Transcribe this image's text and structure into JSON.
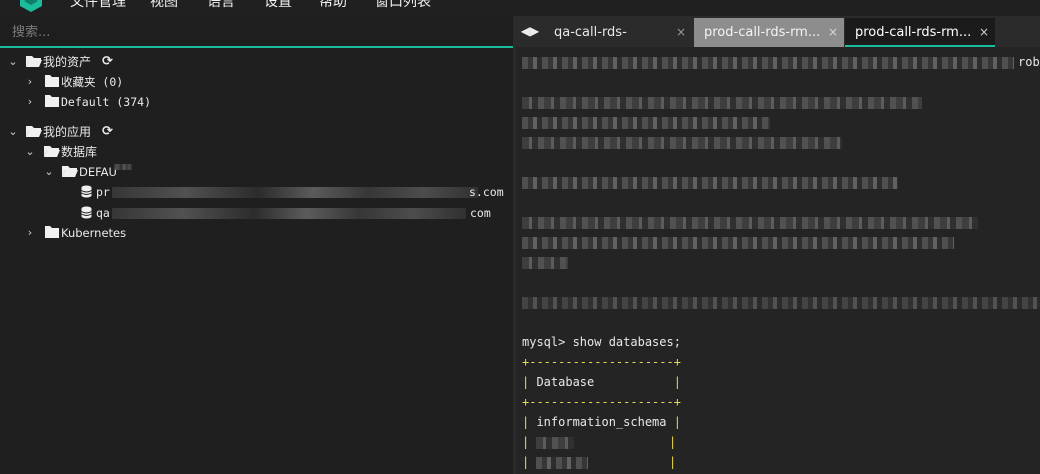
{
  "menu": {
    "items": [
      "文件管理",
      "视图",
      "语言",
      "设置",
      "帮助",
      "窗口列表"
    ]
  },
  "search": {
    "placeholder": "搜索..."
  },
  "tree": {
    "assets_label": "我的资产",
    "favorites_label": "收藏夹 (0)",
    "default_label": "Default (374)",
    "apps_label": "我的应用",
    "db_label": "数据库",
    "default_group_label": "DEFAU",
    "db_item1_prefix": "pr",
    "db_item1_suffix": "s.com",
    "db_item2_prefix": "qa",
    "db_item2_suffix": "com",
    "k8s_label": "Kubernetes"
  },
  "tabs": [
    {
      "label": "qa-call-rds-"
    },
    {
      "label": "prod-call-rds-rm..."
    },
    {
      "label": "prod-call-rds-rm..."
    }
  ],
  "terminal": {
    "line_end_rob": "rob",
    "prompt": "mysql> show databases;",
    "sep": "+--------------------+",
    "header_row_pre": "| ",
    "header": "Database",
    "header_row_post": "           |",
    "row1_pre": "| ",
    "row1": "information_schema",
    "row1_post": " |"
  },
  "colors": {
    "accent": "#1abc9c",
    "active_tab": "#1b1b1b",
    "inactive_tab": "#8d8d8d",
    "table_border": "#e8d84b"
  }
}
